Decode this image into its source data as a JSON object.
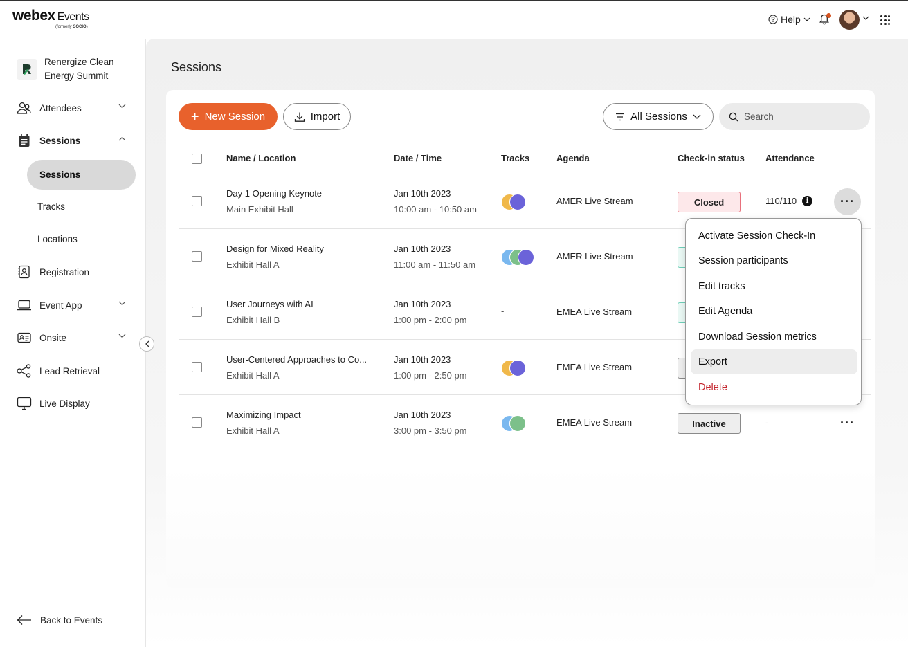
{
  "topbar": {
    "logo_main": "webex",
    "logo_product": "Events",
    "logo_formerly": "(formerly",
    "logo_formerly_brand": "SOCIO",
    "logo_formerly_end": ")",
    "help_label": "Help"
  },
  "sidebar": {
    "event_name": "Renergize Clean Energy Summit",
    "items": [
      {
        "label": "Attendees",
        "icon": "people-icon"
      },
      {
        "label": "Sessions",
        "icon": "calendar-icon"
      },
      {
        "label": "Registration",
        "icon": "badge-icon"
      },
      {
        "label": "Event App",
        "icon": "laptop-icon"
      },
      {
        "label": "Onsite",
        "icon": "id-card-icon"
      },
      {
        "label": "Lead Retrieval",
        "icon": "share-icon"
      },
      {
        "label": "Live Display",
        "icon": "monitor-icon"
      }
    ],
    "sub_items": [
      "Sessions",
      "Tracks",
      "Locations"
    ],
    "back_label": "Back to Events"
  },
  "main": {
    "title": "Sessions",
    "new_session_label": "New Session",
    "import_label": "Import",
    "filter_label": "All Sessions",
    "search_placeholder": "Search"
  },
  "table": {
    "columns": [
      "Name / Location",
      "Date / Time",
      "Tracks",
      "Agenda",
      "Check-in status",
      "Attendance"
    ],
    "rows": [
      {
        "name": "Day 1 Opening Keynote",
        "location": "Main Exhibit Hall",
        "date": "Jan 10th 2023",
        "time": "10:00 am - 10:50 am",
        "tracks": [
          "#f0b84a",
          "#6b63d9"
        ],
        "agenda": "AMER Live Stream",
        "status": "Closed",
        "attendance": "110/110"
      },
      {
        "name": "Design for Mixed Reality",
        "location": "Exhibit Hall A",
        "date": "Jan 10th 2023",
        "time": "11:00 am - 11:50 am",
        "tracks": [
          "#7ab8ef",
          "#7cc08a",
          "#6b63d9"
        ],
        "agenda": "AMER Live Stream",
        "status": "",
        "attendance": ""
      },
      {
        "name": "User Journeys with AI",
        "location": "Exhibit Hall B",
        "date": "Jan 10th 2023",
        "time": "1:00 pm - 2:00 pm",
        "tracks": [],
        "tracks_empty": "-",
        "agenda": "EMEA Live Stream",
        "status": "",
        "attendance": ""
      },
      {
        "name": "User-Centered Approaches to Co...",
        "location": "Exhibit Hall A",
        "date": "Jan 10th 2023",
        "time": "1:00 pm - 2:50 pm",
        "tracks": [
          "#f0b84a",
          "#6b63d9"
        ],
        "agenda": "EMEA Live Stream",
        "status": "",
        "attendance": ""
      },
      {
        "name": "Maximizing Impact",
        "location": "Exhibit Hall A",
        "date": "Jan 10th 2023",
        "time": "3:00 pm - 3:50 pm",
        "tracks": [
          "#7ab8ef",
          "#7cc08a"
        ],
        "agenda": "EMEA Live Stream",
        "status": "Inactive",
        "attendance": "-"
      }
    ]
  },
  "context_menu": {
    "items": [
      "Activate Session Check-In",
      "Session participants",
      "Edit tracks",
      "Edit Agenda",
      "Download Session metrics",
      "Export",
      "Delete"
    ]
  },
  "colors": {
    "accent": "#e8612c",
    "danger": "#c4262e",
    "closed_bg": "#fde8ea",
    "closed_border": "#e8707c",
    "inactive_bg": "#eeeeee",
    "inactive_border": "#8a8a8a",
    "active_border": "#6fcfb8"
  }
}
